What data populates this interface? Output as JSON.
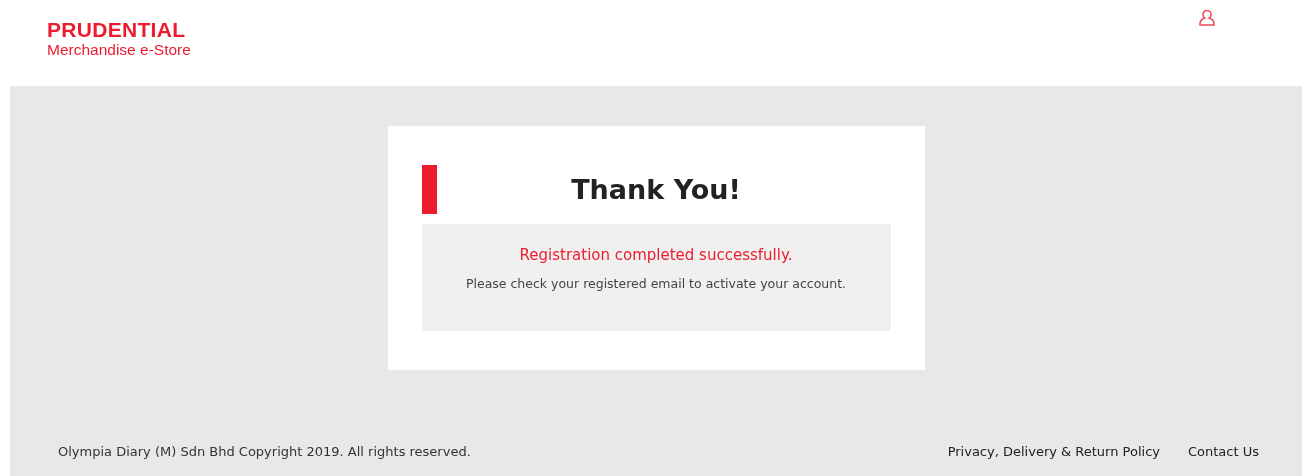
{
  "header": {
    "brand": "PRUDENTIAL",
    "subtitle": "Merchandise e-Store"
  },
  "message": {
    "title": "Thank You!",
    "headline": "Registration completed successfully.",
    "body": "Please check your registered email to activate your account."
  },
  "footer": {
    "copyright": "Olympia Diary (M) Sdn Bhd Copyright 2019. All rights reserved.",
    "links": [
      "Privacy, Delivery & Return Policy",
      "Contact Us"
    ]
  }
}
